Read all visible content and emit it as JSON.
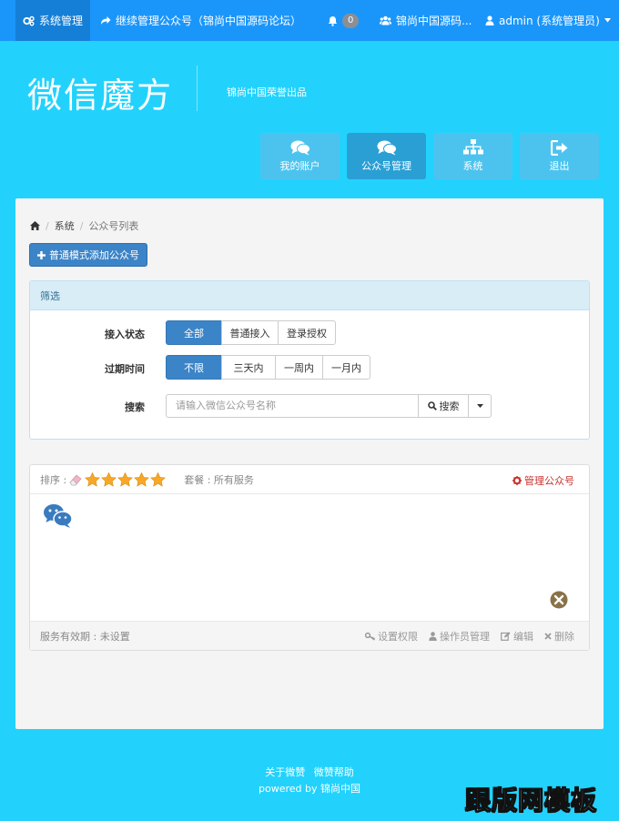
{
  "topnav": {
    "system_manage": "系统管理",
    "continue_manage": "继续管理公众号（锦尚中国源码论坛）",
    "notification_count": "0",
    "group_name": "锦尚中国源码...",
    "user": "admin (系统管理员)"
  },
  "brand": {
    "logo": "微信魔方",
    "slogan": "锦尚中国荣誉出品"
  },
  "tiles": [
    {
      "label": "我的账户",
      "icon": "comments-icon"
    },
    {
      "label": "公众号管理",
      "icon": "comments-icon"
    },
    {
      "label": "系统",
      "icon": "sitemap-icon"
    },
    {
      "label": "退出",
      "icon": "sign-out-icon"
    }
  ],
  "breadcrumb": {
    "system": "系统",
    "current": "公众号列表"
  },
  "add_button": "普通模式添加公众号",
  "filter": {
    "title": "筛选",
    "access_label": "接入状态",
    "access_options": [
      "全部",
      "普通接入",
      "登录授权"
    ],
    "expire_label": "过期时间",
    "expire_options": [
      "不限",
      "三天内",
      "一周内",
      "一月内"
    ],
    "search_label": "搜索",
    "search_placeholder": "请输入微信公众号名称",
    "search_button": "搜索"
  },
  "account_card": {
    "sort_label": "排序 :",
    "package_label": "套餐 : 所有服务",
    "manage_label": "管理公众号",
    "validity": "服务有效期 : 未设置",
    "actions": [
      "设置权限",
      "操作员管理",
      "编辑",
      "删除"
    ]
  },
  "footer": {
    "about": "关于微赞",
    "help": "微赞帮助",
    "powered": "powered by 锦尚中国"
  },
  "watermark": "跟版网模板"
}
